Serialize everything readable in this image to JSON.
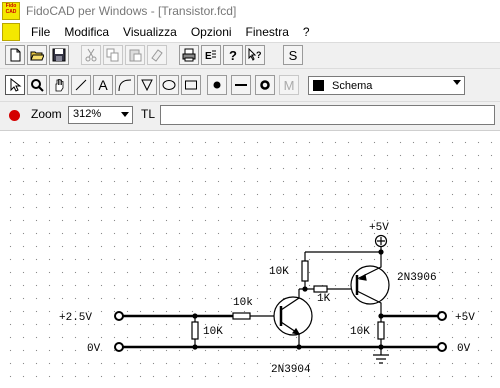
{
  "window": {
    "app_icon_text": "Fido CAD",
    "title": "FidoCAD per Windows - [Transistor.fcd]"
  },
  "menu": {
    "items": [
      "File",
      "Modifica",
      "Visualizza",
      "Opzioni",
      "Finestra",
      "?"
    ]
  },
  "toolbar_main": {
    "icons": [
      "new-file-icon",
      "open-folder-icon",
      "save-icon",
      "cut-icon",
      "copy-icon",
      "paste-icon",
      "erase-icon",
      "print-icon",
      "export-icon",
      "help-icon",
      "context-help-icon",
      "s-icon"
    ],
    "s_label": "S"
  },
  "toolbar_tools": {
    "tools": [
      "pointer-tool",
      "zoom-tool",
      "pan-hand-tool",
      "line-tool",
      "text-tool",
      "bezier-tool",
      "polygon-tool",
      "ellipse-tool",
      "rectangle-tool",
      "dot-tool",
      "line-segment-tool",
      "pad-tool",
      "macro-tool"
    ],
    "text_tool_label": "A",
    "macro_tool_label": "M",
    "layer": {
      "name": "Schema",
      "color": "#000000"
    }
  },
  "toolbar_zoom": {
    "zoom_label": "Zoom",
    "zoom_value": "312%",
    "tl_label": "TL",
    "tl_value": ""
  },
  "schematic": {
    "labels": {
      "vcc": "+5V",
      "r_top": "10K",
      "q2": "2N3906",
      "r_mid": "1K",
      "r_base": "10k",
      "in_plus": "+2.5V",
      "r_in": "10K",
      "out_plus": "+5V",
      "gnd_left": "0V",
      "gnd_right": "0V",
      "r_out": "10K",
      "q1": "2N3904"
    }
  }
}
